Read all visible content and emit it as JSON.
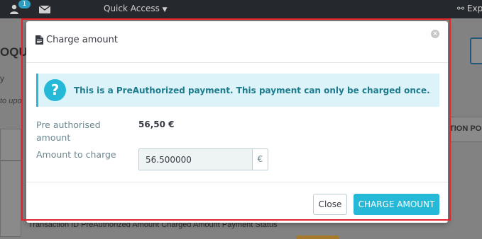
{
  "topbar": {
    "notification_count": "1",
    "quick_access_label": "Quick Access",
    "explore_label": "Expl"
  },
  "background": {
    "heading_fragment": "OQU",
    "label_fragment": "y",
    "hint_fragment": "to upd",
    "section_fragment": "TION POL",
    "table_headers_fragment": "Transaction ID   PreAuthorized Amount   Charged Amount   Payment Status"
  },
  "modal": {
    "title": "Charge amount",
    "close_symbol": "×",
    "alert": {
      "icon_symbol": "?",
      "text": "This is a PreAuthorized payment. This payment can only be charged once."
    },
    "fields": {
      "preauth_label": "Pre authorised amount",
      "preauth_value": "56,50 €",
      "amount_label": "Amount to charge",
      "amount_value": "56.500000",
      "currency": "€"
    },
    "footer": {
      "close_label": "Close",
      "charge_label": "CHARGE AMOUNT"
    }
  },
  "colors": {
    "accent": "#25b9d7",
    "highlight_outline": "#e4242b",
    "alert_bg": "#dcf4f9"
  }
}
